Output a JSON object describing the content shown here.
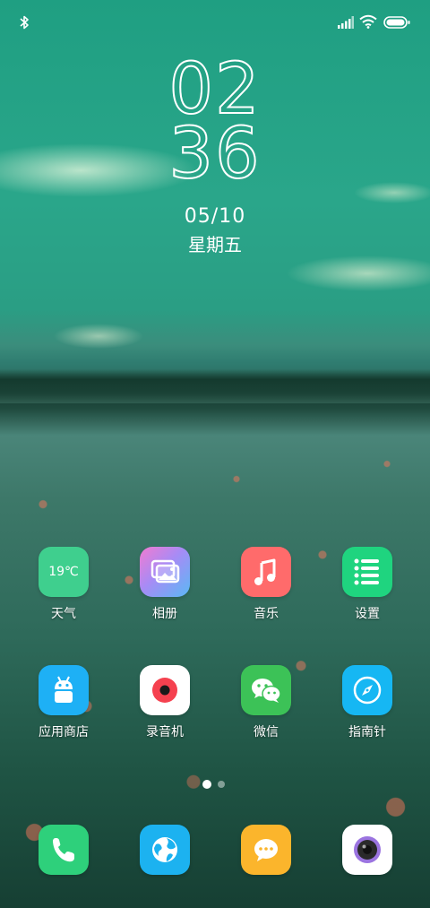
{
  "clock": {
    "hour": "02",
    "minute": "36",
    "date": "05/10",
    "weekday": "星期五"
  },
  "status_bar": {
    "icons": [
      "bluetooth-icon",
      "signal-icon",
      "wifi-icon",
      "battery-icon"
    ]
  },
  "apps": {
    "row1": [
      {
        "label": "天气",
        "icon": "weather-icon",
        "temp": "19℃",
        "color": "#3fcf8e"
      },
      {
        "label": "相册",
        "icon": "gallery-icon",
        "color": "#5ea8f5"
      },
      {
        "label": "音乐",
        "icon": "music-icon",
        "color": "#ff6b6b"
      },
      {
        "label": "设置",
        "icon": "settings-icon",
        "color": "#1fd47f"
      }
    ],
    "row2": [
      {
        "label": "应用商店",
        "icon": "android-icon",
        "color": "#1eb0f5"
      },
      {
        "label": "录音机",
        "icon": "recorder-icon",
        "color": "#ffffff"
      },
      {
        "label": "微信",
        "icon": "wechat-icon",
        "color": "#3cc257"
      },
      {
        "label": "指南针",
        "icon": "compass-icon",
        "color": "#16b7f3"
      }
    ]
  },
  "dock": [
    {
      "icon": "phone-icon",
      "color": "#2ed07b"
    },
    {
      "icon": "browser-icon",
      "color": "#1cb2f0"
    },
    {
      "icon": "messages-icon",
      "color": "#fbb52c"
    },
    {
      "icon": "camera-icon",
      "color": "#ffffff"
    }
  ],
  "page_indicator": {
    "pages": 2,
    "active": 1
  }
}
